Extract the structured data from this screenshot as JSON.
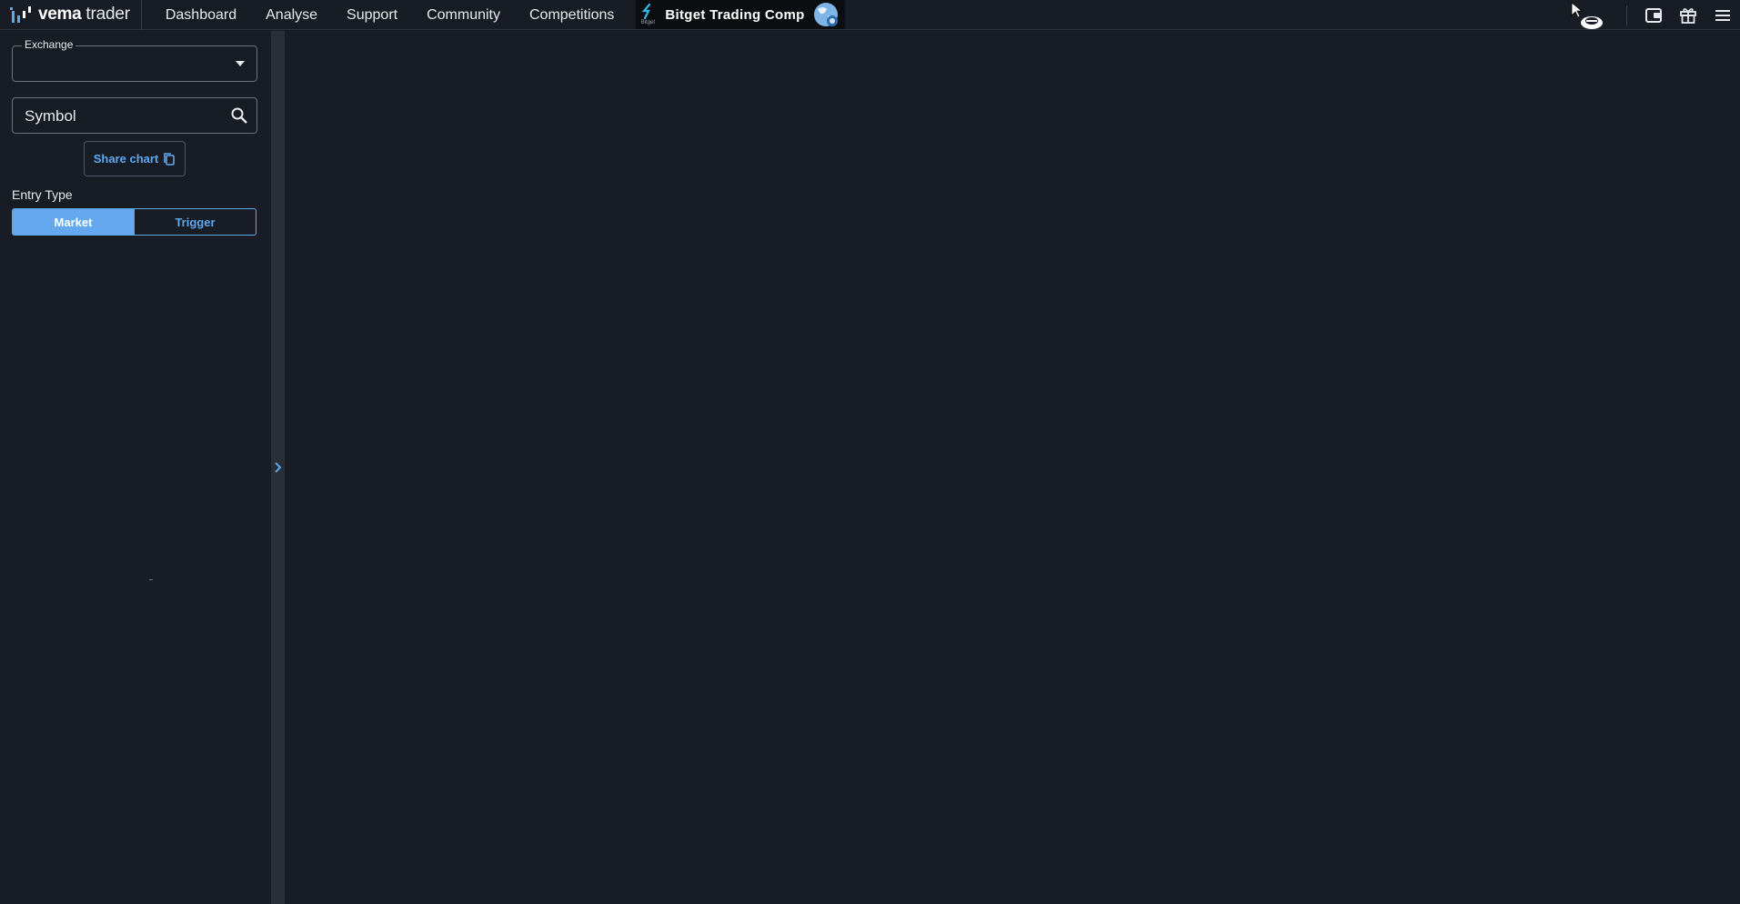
{
  "brand": {
    "name_bold": "vema",
    "name_light": "trader"
  },
  "nav": {
    "items": [
      "Dashboard",
      "Analyse",
      "Support",
      "Community",
      "Competitions"
    ]
  },
  "promo": {
    "logo_text": "Bitget",
    "label": "Bitget Trading Comp"
  },
  "sidebar": {
    "exchange_label": "Exchange",
    "exchange_value": "",
    "symbol_placeholder": "Symbol",
    "share_label": "Share chart",
    "entry_type_label": "Entry Type",
    "entry_options": [
      "Market",
      "Trigger"
    ],
    "entry_selected": "Market"
  },
  "colors": {
    "background": "#181c25",
    "accent": "#5ea8f0",
    "active_toggle": "#64a9ef",
    "splitter": "#2a2e36"
  },
  "icons": {
    "logo": "vema-logo-icon",
    "dropdown": "caret-down-icon",
    "search": "search-icon",
    "copy": "copy-icon",
    "globe": "globe-icon",
    "avatar": "avatar-icon",
    "wallet": "wallet-icon",
    "gift": "gift-icon",
    "menu": "hamburger-menu-icon",
    "expand": "chevron-right-icon"
  }
}
